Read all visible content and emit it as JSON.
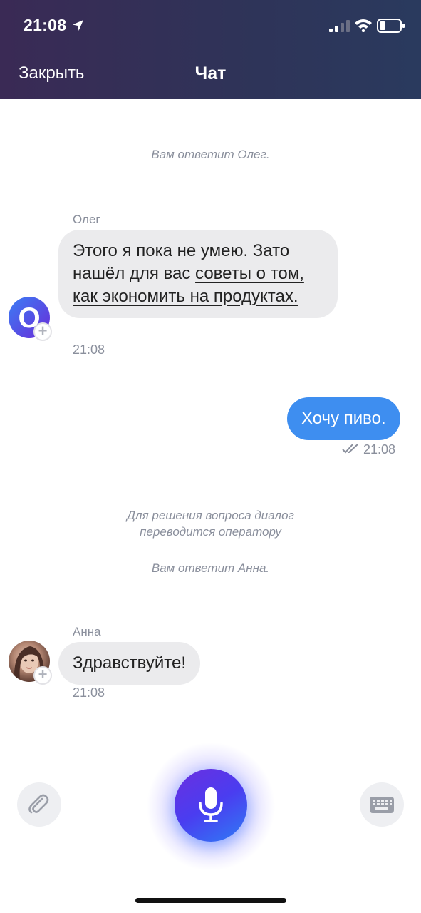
{
  "status_bar": {
    "time": "21:08"
  },
  "header": {
    "close_label": "Закрыть",
    "title": "Чат"
  },
  "messages": {
    "system_1": "Вам ответит Олег.",
    "oleg": {
      "sender": "Олег",
      "avatar_letter": "О",
      "text_before": "Этого я пока не умею. Зато нашёл для вас ",
      "link_text": "советы о том, как экономить на продуктах.",
      "time": "21:08"
    },
    "user": {
      "text": "Хочу пиво.",
      "time": "21:08"
    },
    "system_2": "Для решения вопроса диалог переводится оператору",
    "system_3": "Вам ответит Анна.",
    "anna": {
      "sender": "Анна",
      "text": "Здравствуйте!",
      "time": "21:08"
    }
  },
  "icons": {
    "attach": "paperclip-icon",
    "mic": "microphone-icon",
    "keyboard": "keyboard-icon"
  },
  "colors": {
    "header_bg": "#2f3358",
    "user_bubble": "#3e8ef0",
    "incoming_bubble": "#ebebed",
    "mic_gradient_start": "#6b2fe0",
    "mic_gradient_end": "#2f7cf5"
  }
}
